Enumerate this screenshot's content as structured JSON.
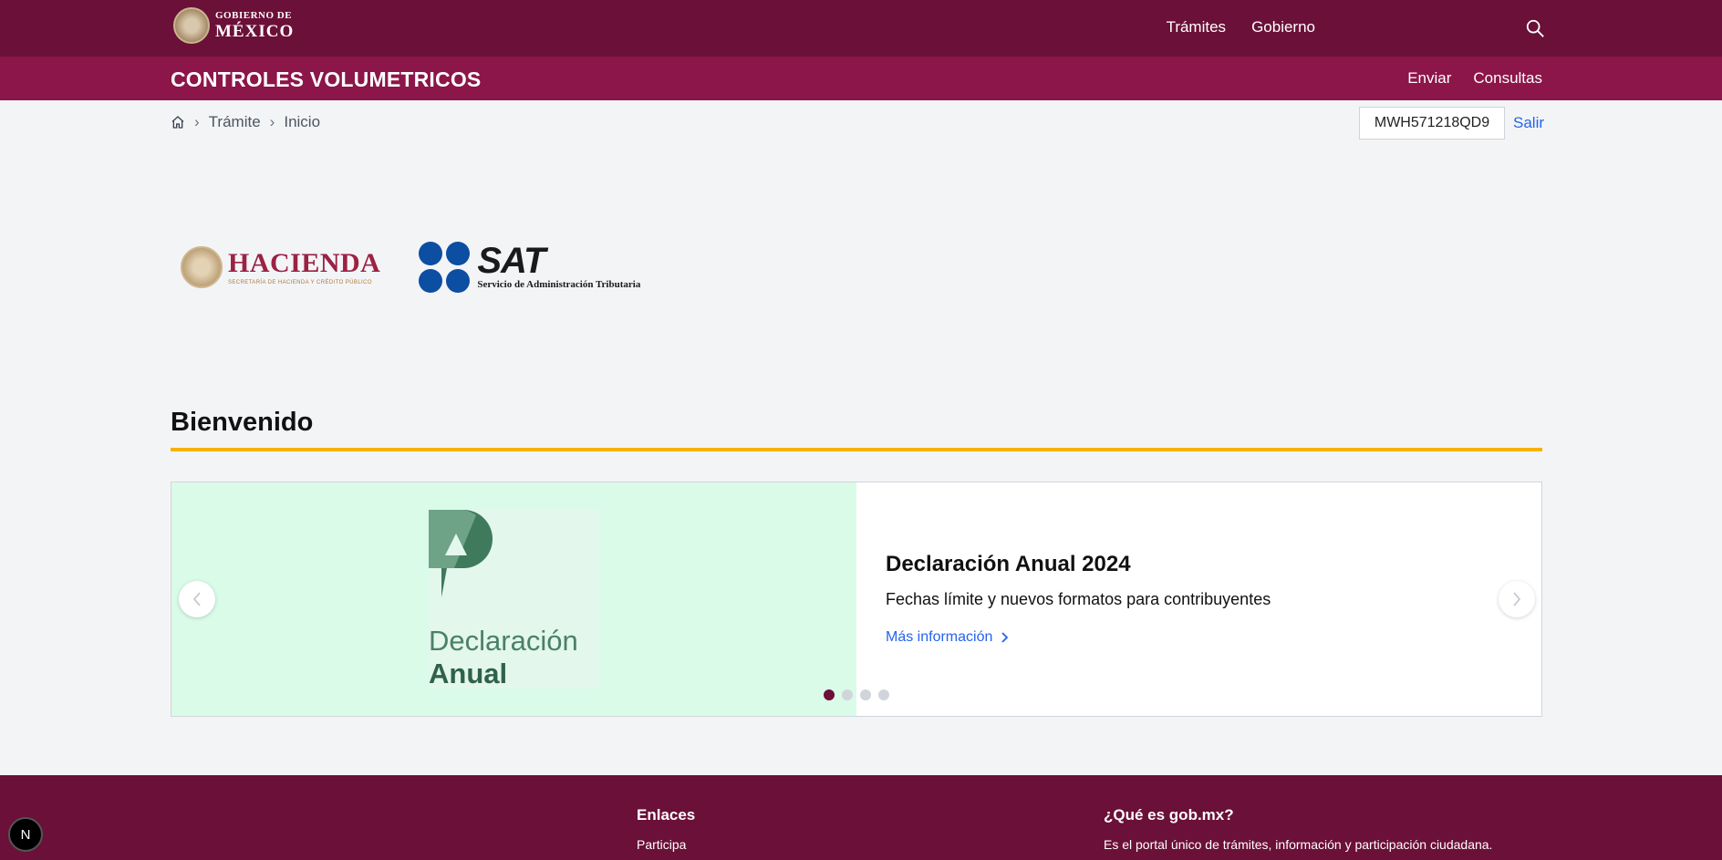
{
  "header": {
    "gov_logo": {
      "line1": "GOBIERNO DE",
      "line2": "MÉXICO"
    },
    "nav": [
      "Trámites",
      "Gobierno"
    ],
    "search_icon": "search-icon"
  },
  "subheader": {
    "title": "CONTROLES VOLUMETRICOS",
    "nav": [
      "Enviar",
      "Consultas"
    ]
  },
  "breadcrumb": {
    "home_icon": "home-icon",
    "items": [
      "Trámite",
      "Inicio"
    ]
  },
  "user": {
    "rfc": "MWH571218QD9",
    "logout_label": "Salir"
  },
  "logos": {
    "hacienda": {
      "name": "HACIENDA",
      "subtitle": "SECRETARÍA DE HACIENDA Y CRÉDITO PÚBLICO"
    },
    "sat": {
      "name": "SAT",
      "subtitle": "Servicio de Administración Tributaria"
    }
  },
  "welcome": {
    "title": "Bienvenido"
  },
  "carousel": {
    "image_text": {
      "line1": "Declaración",
      "line2": "Anual"
    },
    "slide_title": "Declaración Anual 2024",
    "slide_description": "Fechas límite y nuevos formatos para contribuyentes",
    "link_label": "Más información",
    "slide_count": 4,
    "active_index": 0
  },
  "footer": {
    "links_title": "Enlaces",
    "links": [
      "Participa"
    ],
    "about_title": "¿Qué es gob.mx?",
    "about_text": "Es el portal único de trámites, información y participación ciudadana."
  },
  "badge": {
    "label": "N"
  },
  "colors": {
    "primary": "#6b1038",
    "secondary": "#8c1549",
    "accent_line": "#f5b20a",
    "link": "#2563eb",
    "slide_bg": "#d9fbe8"
  }
}
